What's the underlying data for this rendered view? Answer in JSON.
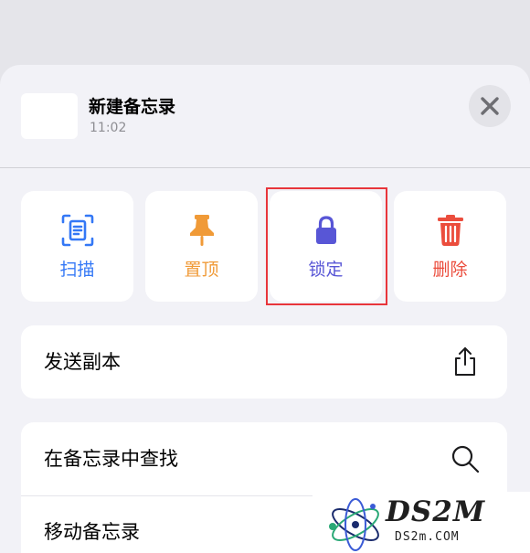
{
  "note": {
    "title": "新建备忘录",
    "time": "11:02"
  },
  "actions": [
    {
      "label": "扫描",
      "icon": "scan-document-icon",
      "color": "#3478f6"
    },
    {
      "label": "置顶",
      "icon": "pin-icon",
      "color": "#f09a37"
    },
    {
      "label": "锁定",
      "icon": "lock-icon",
      "color": "#5856d6"
    },
    {
      "label": "删除",
      "icon": "trash-icon",
      "color": "#eb4d3d"
    }
  ],
  "rows": {
    "send_copy": {
      "label": "发送副本",
      "icon": "share-icon"
    },
    "find_in_note": {
      "label": "在备忘录中查找",
      "icon": "search-icon"
    },
    "move_note": {
      "label": "移动备忘录"
    }
  },
  "watermark": {
    "brand": "DS2M",
    "url": "DS2m.COM"
  }
}
